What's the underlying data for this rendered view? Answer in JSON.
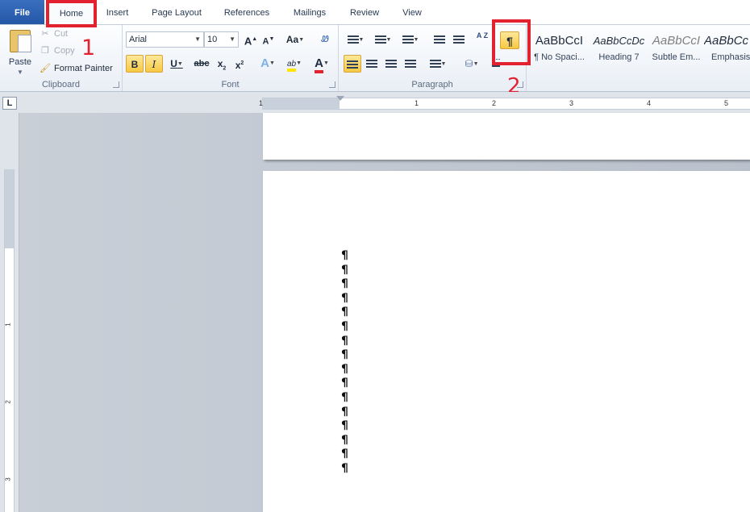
{
  "tabs": [
    {
      "id": "file",
      "label": "File"
    },
    {
      "id": "home",
      "label": "Home"
    },
    {
      "id": "insert",
      "label": "Insert"
    },
    {
      "id": "page-layout",
      "label": "Page Layout"
    },
    {
      "id": "references",
      "label": "References"
    },
    {
      "id": "mailings",
      "label": "Mailings"
    },
    {
      "id": "review",
      "label": "Review"
    },
    {
      "id": "view",
      "label": "View"
    }
  ],
  "annotations": {
    "step1": "1",
    "step2": "2",
    "highlight_color": "#e3222f"
  },
  "clipboard": {
    "label": "Clipboard",
    "paste": "Paste",
    "cut": "Cut",
    "copy": "Copy",
    "format_painter": "Format Painter"
  },
  "font": {
    "label": "Font",
    "font_name": "Arial",
    "font_size": "10",
    "grow": "A",
    "shrink": "A",
    "change_case": "Aa",
    "bold": "B",
    "italic": "I",
    "underline": "U",
    "strikethrough": "abc",
    "subscript": "x",
    "superscript": "x",
    "text_effects": "A",
    "highlight": "ab",
    "font_color": "A"
  },
  "paragraph": {
    "label": "Paragraph",
    "show_hide_mark": "¶",
    "sort": "A Z"
  },
  "styles": [
    {
      "sample": "AaBbCcI",
      "name": "¶ No Spaci..."
    },
    {
      "sample": "AaBbCcDc",
      "name": "Heading 7"
    },
    {
      "sample": "AaBbCcI",
      "name": "Subtle Em..."
    },
    {
      "sample": "AaBbCc",
      "name": "Emphasis"
    }
  ],
  "ruler": {
    "h_numbers": [
      "1",
      "1",
      "2",
      "3",
      "4",
      "5"
    ],
    "v_numbers": [
      "1",
      "2",
      "3"
    ]
  },
  "document": {
    "paragraph_marks": [
      "¶",
      "¶",
      "¶",
      "¶",
      "¶",
      "¶",
      "¶",
      "¶",
      "¶",
      "¶",
      "¶",
      "¶",
      "¶",
      "¶",
      "¶",
      "¶"
    ]
  },
  "colors": {
    "accent": "#2457a6",
    "active_button": "#f7c943",
    "font_color_bar": "#e3222f",
    "highlight_bar": "#ffe600"
  }
}
